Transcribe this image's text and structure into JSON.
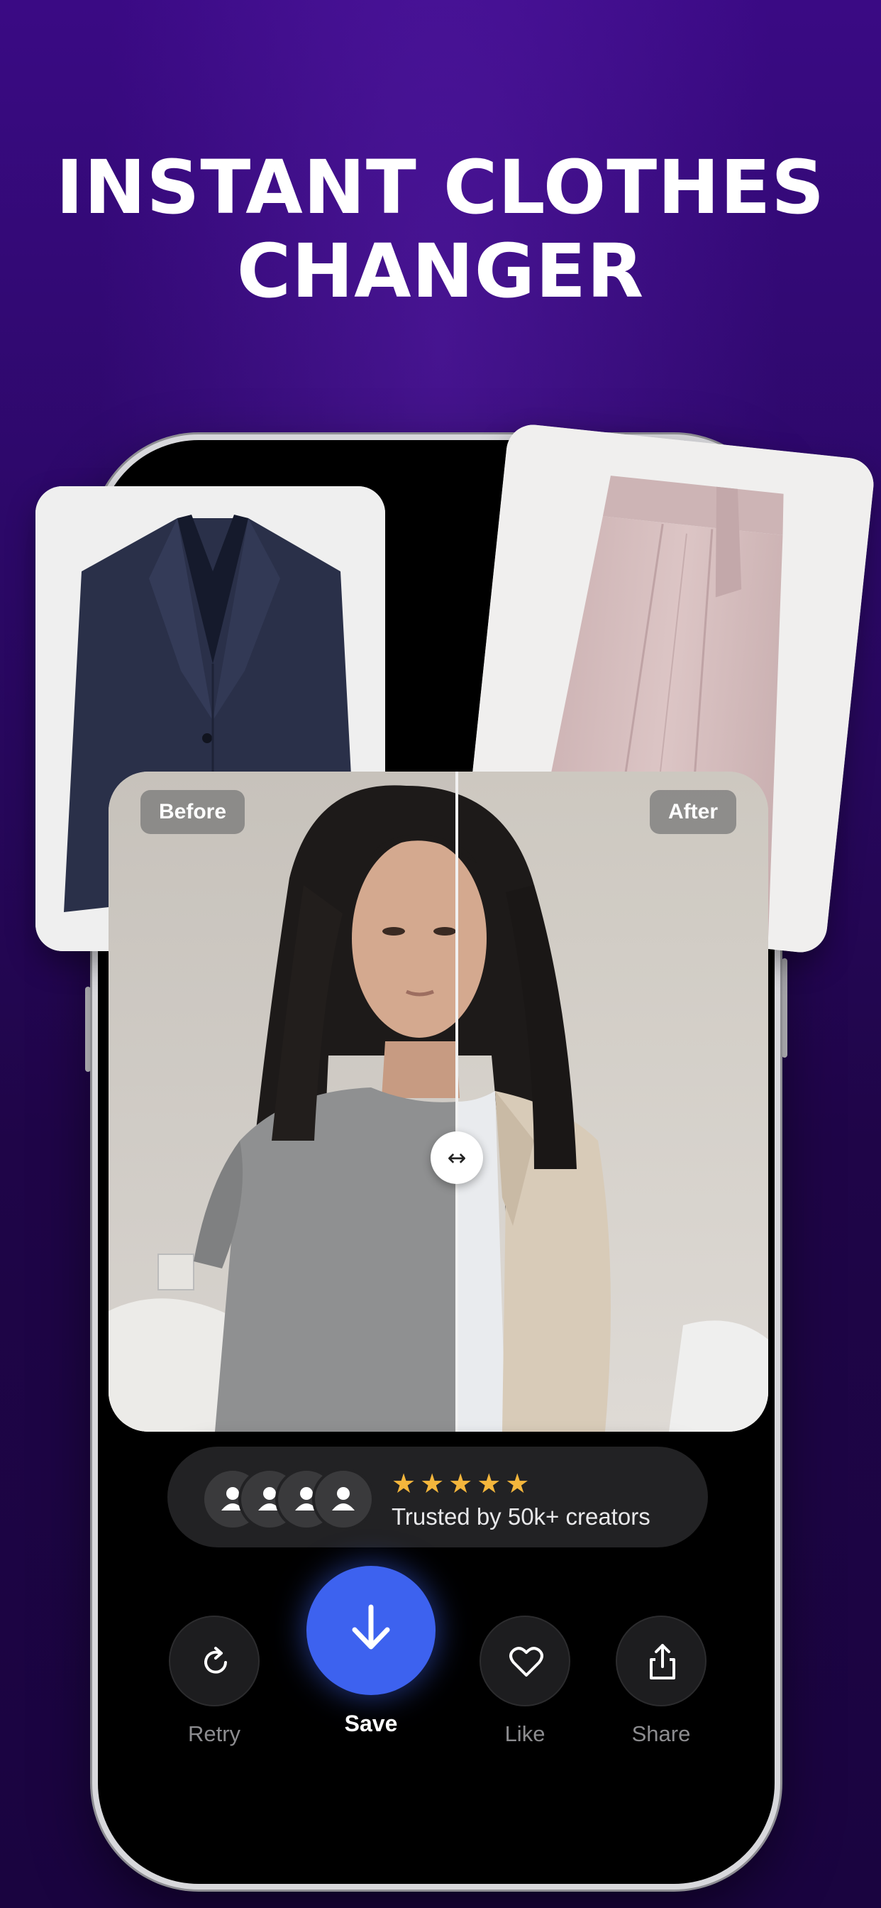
{
  "headline": {
    "line1": "INSTANT CLOTHES",
    "line2": "CHANGER"
  },
  "comparison": {
    "before_label": "Before",
    "after_label": "After",
    "handle_icon": "↔"
  },
  "trust": {
    "stars": "★★★★★",
    "text": "Trusted by 50k+ creators"
  },
  "actions": {
    "retry": "Retry",
    "save": "Save",
    "like": "Like",
    "share": "Share"
  },
  "colors": {
    "background": "#2b0866",
    "save_button": "#3d62ef",
    "stars": "#f4b63c"
  },
  "icons": [
    "retry-icon",
    "download-icon",
    "heart-icon",
    "share-icon",
    "user-icon",
    "swap-arrows-icon"
  ]
}
